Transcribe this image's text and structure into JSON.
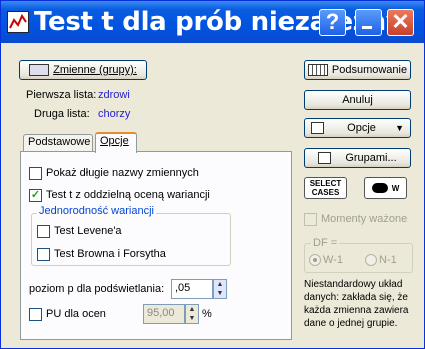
{
  "window": {
    "title": "Test t dla prób niezależny"
  },
  "icons": {
    "app": "app-icon",
    "help": "help-icon",
    "minimize": "minimize-icon",
    "close": "close-icon"
  },
  "buttons": {
    "variables": "Zmienne (grupy):",
    "summary": "Podsumowanie",
    "cancel": "Anuluj",
    "options": "Opcje",
    "by_groups": "Grupami...",
    "select_cases": "SELECT CASES",
    "weight": "W"
  },
  "lists": {
    "first_label": "Pierwsza lista:",
    "first_value": "zdrowi",
    "second_label": "Druga lista:",
    "second_value": "chorzy"
  },
  "tabs": [
    {
      "label": "Podstawowe"
    },
    {
      "label": "Opcje",
      "active": true
    }
  ],
  "options": {
    "long_names": {
      "label": "Pokaż długie nazwy zmiennych",
      "checked": false
    },
    "separate_variance": {
      "label": "Test t z oddzielną oceną wariancji",
      "checked": true
    },
    "homogeneity_title": "Jednorodność wariancji",
    "levene": {
      "label": "Test Levene'a",
      "checked": false
    },
    "brown_forsyth": {
      "label": "Test Browna i Forsytha",
      "checked": false
    },
    "p_level_label": "poziom p dla podświetlania:",
    "p_level_value": ",05",
    "pu_label": "PU dla ocen",
    "pu_checked": false,
    "pu_value": "95,00",
    "pu_unit": "%"
  },
  "right": {
    "weighted_moments": "Momenty ważone",
    "df_label": "DF =",
    "df_opt1": "W-1",
    "df_opt2": "N-1",
    "note": "Niestandardowy układ danych: zakłada się, że każda zmienna zawiera dane o jednej grupie."
  },
  "colors": {
    "title_bar": "#0054e3",
    "dialog_bg": "#ece9d8",
    "value_text": "#1f1fcc",
    "group_title": "#0046d5"
  }
}
